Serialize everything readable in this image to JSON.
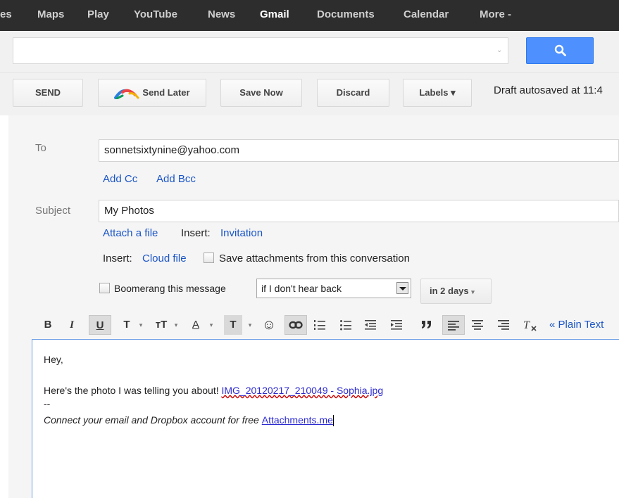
{
  "nav": {
    "items": [
      "es",
      "Maps",
      "Play",
      "YouTube",
      "News",
      "Gmail",
      "Documents",
      "Calendar",
      "More -"
    ],
    "active": "Gmail"
  },
  "search": {
    "value": "",
    "button_icon": "search-icon",
    "caret": "⌄"
  },
  "toolbar": {
    "send": "SEND",
    "send_later": "Send Later",
    "send_later_icon": "boomerang-icon",
    "save_now": "Save Now",
    "discard": "Discard",
    "labels": "Labels ▾",
    "status": "Draft autosaved at 11:4"
  },
  "compose": {
    "to_label": "To",
    "to_value": "sonnetsixtynine@yahoo.com",
    "add_cc": "Add Cc",
    "add_bcc": "Add Bcc",
    "subject_label": "Subject",
    "subject_value": "My Photos",
    "attach_file": "Attach a file",
    "insert_label": "Insert:",
    "invitation": "Invitation",
    "cloud_file": "Cloud file",
    "save_attachments": "Save attachments from this conversation",
    "boomerang_label": "Boomerang this message",
    "boomerang_condition": "if I don't hear back",
    "boomerang_days": "in 2 days"
  },
  "format_toolbar": {
    "bold": "B",
    "italic": "I",
    "underline": "U",
    "font": "T",
    "size": "тT",
    "text_color": "A",
    "highlight": "T",
    "emoji": "☺",
    "dropdown_marker": "▾",
    "plain_text": "« Plain Text"
  },
  "body": {
    "greeting": "Hey,",
    "line1_text": "Here's the photo I was telling you about! ",
    "line1_link": "IMG_20120217_210049 - Sophia.jpg",
    "separator": "--",
    "sig_text": "Connect your email and Dropbox account for free ",
    "sig_link": "Attachments.me"
  },
  "colors": {
    "accent": "#4d90fe",
    "link": "#1a55c7",
    "topbar": "#2d2d2d"
  }
}
